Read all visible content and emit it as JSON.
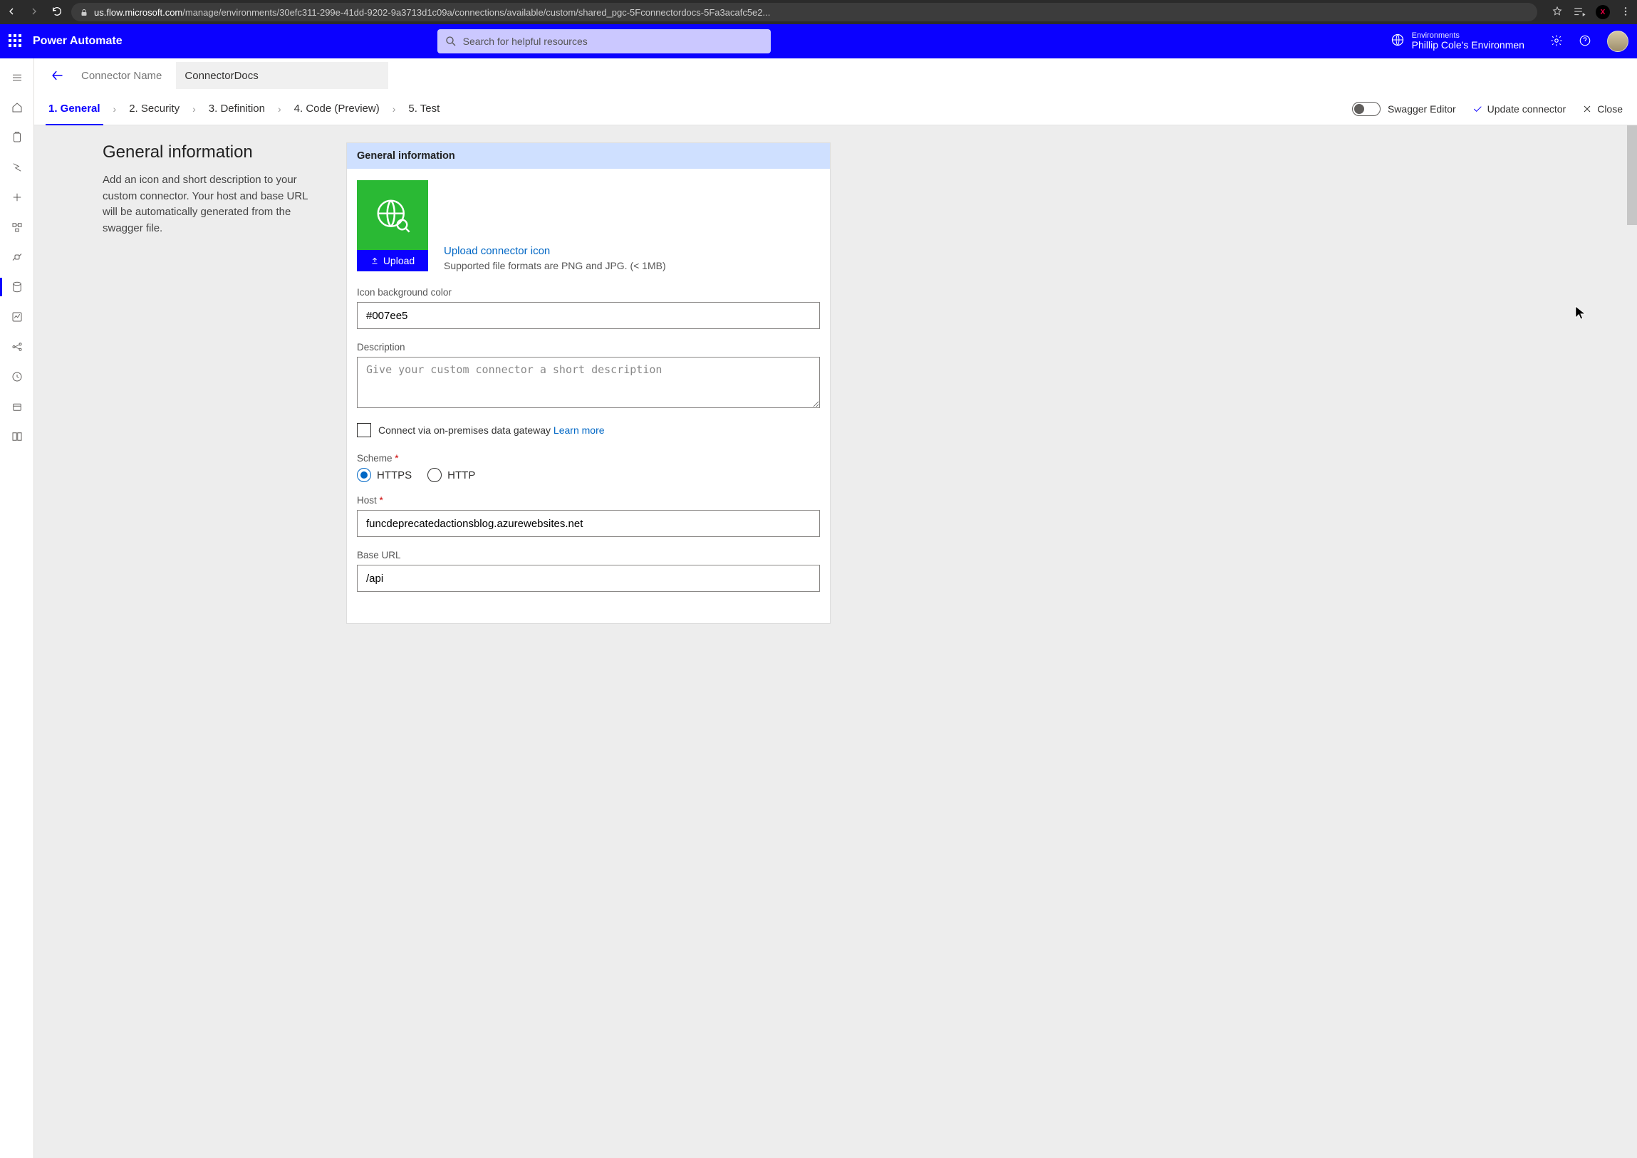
{
  "browser": {
    "url_prefix": "us.flow.microsoft.com",
    "url_rest": "/manage/environments/30efc311-299e-41dd-9202-9a3713d1c09a/connections/available/custom/shared_pgc-5Fconnectordocs-5Fa3acafc5e2..."
  },
  "header": {
    "app_title": "Power Automate",
    "search_placeholder": "Search for helpful resources",
    "env_label": "Environments",
    "env_name": "Phillip Cole's Environmen"
  },
  "name_row": {
    "label": "Connector Name",
    "value": "ConnectorDocs"
  },
  "steps": {
    "s1": "1. General",
    "s2": "2. Security",
    "s3": "3. Definition",
    "s4": "4. Code (Preview)",
    "s5": "5. Test",
    "swagger": "Swagger Editor",
    "update": "Update connector",
    "close": "Close"
  },
  "left_pane": {
    "title": "General information",
    "desc": "Add an icon and short description to your custom connector. Your host and base URL will be automatically generated from the swagger file."
  },
  "panel": {
    "header": "General information",
    "upload_label": "Upload",
    "upload_link": "Upload connector icon",
    "upload_sub": "Supported file formats are PNG and JPG. (< 1MB)",
    "icon_bg_label": "Icon background color",
    "icon_bg_value": "#007ee5",
    "desc_label": "Description",
    "desc_placeholder": "Give your custom connector a short description",
    "gateway_text": "Connect via on-premises data gateway ",
    "gateway_link": "Learn more",
    "scheme_label": "Scheme",
    "https": "HTTPS",
    "http": "HTTP",
    "host_label": "Host",
    "host_value": "funcdeprecatedactionsblog.azurewebsites.net",
    "base_label": "Base URL",
    "base_value": "/api"
  }
}
